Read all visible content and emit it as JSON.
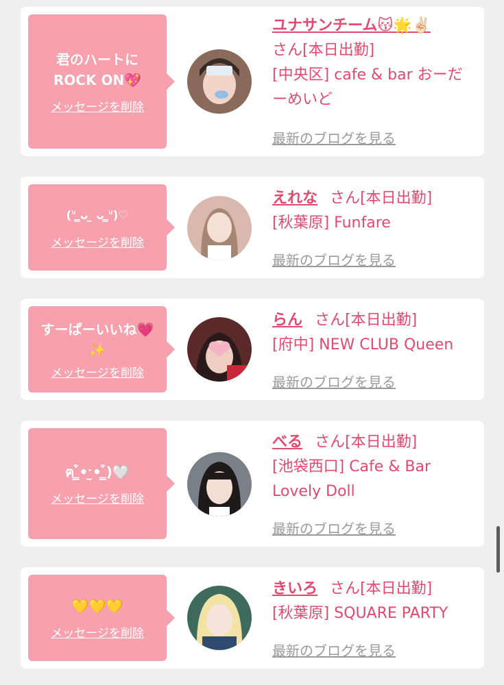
{
  "common": {
    "delete_label": "メッセージを削除",
    "blog_label": "最新のブログを見る",
    "san_suffix": "さん[本日出勤]"
  },
  "colors": {
    "bubble": "#f7a1ae",
    "accent": "#e04a6f",
    "link_gray": "#9a9a9a",
    "background": "#efefef"
  },
  "entries": [
    {
      "message_line1": "君のハートに",
      "message_line2": "ROCK ON💖",
      "name": "ユナサンチーム😽🌟✌🏻",
      "shop": "[中央区] cafe & bar おーだーめいど"
    },
    {
      "message_line1": "(ᐡ ̳ᴗ ̫ ᴗ ̳ᐡ)♡",
      "message_line2": "",
      "name": "えれな",
      "shop": "[秋葉原] Funfare"
    },
    {
      "message_line1": "すーぱーいいね💗",
      "message_line2": "✨",
      "name": "らん",
      "shop": "[府中] NEW CLUB Queen"
    },
    {
      "message_line1": "ฅ ̳͒•ˑ̫• ̳͒)🤍",
      "message_line2": "",
      "name": "べる",
      "shop": "[池袋西口] Cafe & Bar Lovely Doll"
    },
    {
      "message_line1": "💛💛💛",
      "message_line2": "",
      "name": "きいろ",
      "shop": "[秋葉原] SQUARE PARTY"
    }
  ]
}
